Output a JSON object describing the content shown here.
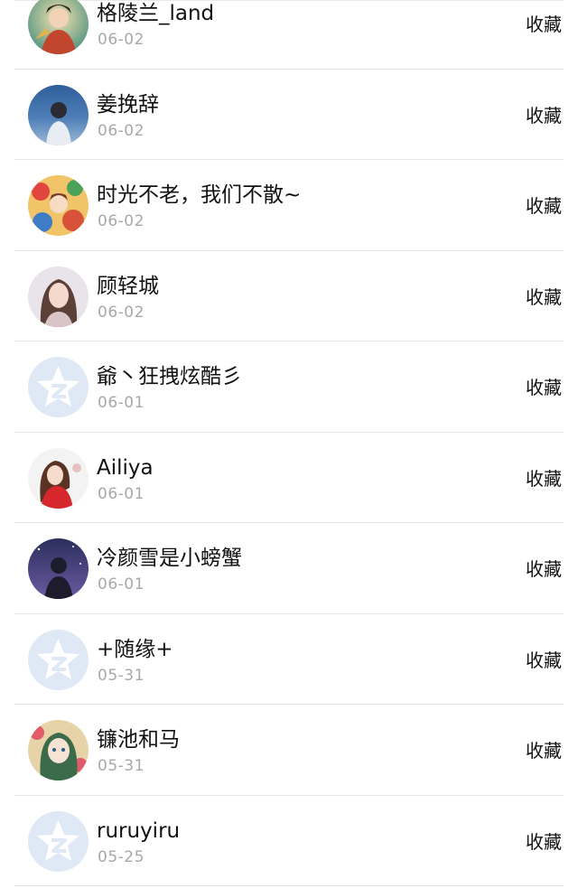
{
  "action_label": "收藏",
  "items": [
    {
      "name": "格陵兰_land",
      "date": "06-02",
      "avatar": "avatar-illustrated-hero"
    },
    {
      "name": "姜挽辞",
      "date": "06-02",
      "avatar": "avatar-seaside-girl"
    },
    {
      "name": "时光不老，我们不散~",
      "date": "06-02",
      "avatar": "avatar-colorful-art"
    },
    {
      "name": "顾轻城",
      "date": "06-02",
      "avatar": "avatar-woman-portrait"
    },
    {
      "name": "爺丶狂拽炫酷彡",
      "date": "06-01",
      "avatar": "default-qzone-star-icon"
    },
    {
      "name": "Ailiya",
      "date": "06-01",
      "avatar": "avatar-red-coat-girl"
    },
    {
      "name": "冷颜雪是小螃蟹",
      "date": "06-01",
      "avatar": "avatar-night-silhouette"
    },
    {
      "name": "+随缘+",
      "date": "05-31",
      "avatar": "default-qzone-star-icon"
    },
    {
      "name": "镰池和马",
      "date": "05-31",
      "avatar": "avatar-anime-girl"
    },
    {
      "name": "ruruyiru",
      "date": "05-25",
      "avatar": "default-qzone-star-icon"
    }
  ],
  "colors": {
    "text": "#111111",
    "date": "#a8a8a8",
    "divider": "#e6e6e6",
    "default_avatar_bg": "#dfe8f5"
  }
}
